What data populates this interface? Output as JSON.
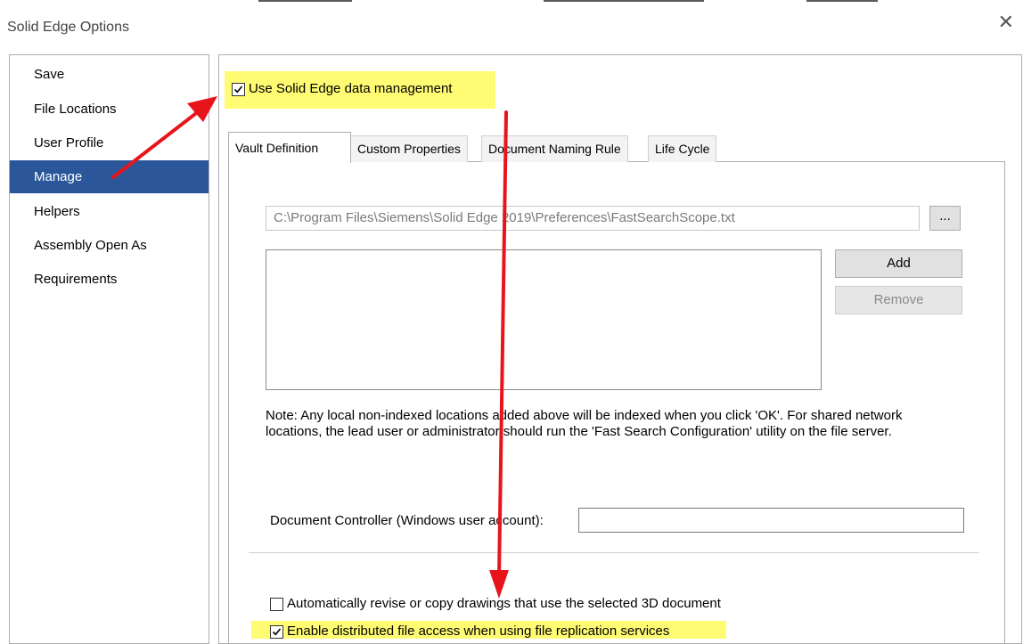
{
  "window": {
    "title": "Solid Edge Options",
    "close_glyph": "✕"
  },
  "sidebar": {
    "items": [
      {
        "label": "Save"
      },
      {
        "label": "File Locations"
      },
      {
        "label": "User Profile"
      },
      {
        "label": "Manage"
      },
      {
        "label": "Helpers"
      },
      {
        "label": "Assembly Open As"
      },
      {
        "label": "Requirements"
      }
    ],
    "selected": "Manage",
    "selected_color": "#2b579a"
  },
  "manage": {
    "use_data_management": {
      "label": "Use Solid Edge data management",
      "checked": true
    },
    "tabs": [
      {
        "label": "Vault Definition",
        "active": true
      },
      {
        "label": "Custom Properties",
        "active": false
      },
      {
        "label": "Document Naming Rule",
        "active": false
      },
      {
        "label": "Life Cycle",
        "active": false
      }
    ],
    "vault": {
      "path_value": "C:\\Program Files\\Siemens\\Solid Edge 2019\\Preferences\\FastSearchScope.txt",
      "browse_label": "...",
      "add_label": "Add",
      "remove_label": "Remove",
      "note": "Note: Any local non-indexed locations added above will be indexed when you click 'OK'. For shared network locations, the lead user or administrator should run the 'Fast Search Configuration' utility on the file server.",
      "controller_label": "Document Controller (Windows user account):",
      "controller_value": ""
    },
    "options": [
      {
        "label": "Automatically revise or copy drawings that use the selected 3D document",
        "checked": false
      },
      {
        "label": "Enable distributed file access when using file replication services",
        "checked": true
      }
    ]
  },
  "colors": {
    "highlight": "#fffb73",
    "annotation_arrow": "#e8141c"
  }
}
